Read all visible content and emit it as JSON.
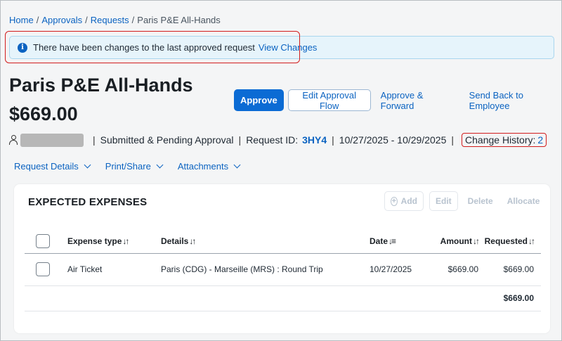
{
  "breadcrumb": {
    "home": "Home",
    "approvals": "Approvals",
    "requests": "Requests",
    "current": "Paris P&E All-Hands",
    "separator": "/"
  },
  "alert": {
    "message": "There have been changes to the last approved request",
    "link": "View Changes"
  },
  "request": {
    "title": "Paris P&E All-Hands",
    "amount": "$669.00",
    "status": "Submitted & Pending Approval",
    "request_id_label": "Request ID:",
    "request_id": "3HY4",
    "dates": "10/27/2025 - 10/29/2025",
    "change_history_label": "Change History:",
    "change_history_count": "2"
  },
  "actions": {
    "approve": "Approve",
    "edit_flow": "Edit Approval Flow",
    "approve_forward": "Approve & Forward",
    "send_back": "Send Back to Employee"
  },
  "tabs": {
    "details": "Request Details",
    "print": "Print/Share",
    "attachments": "Attachments"
  },
  "expenses": {
    "title": "EXPECTED EXPENSES",
    "toolbar": {
      "add": "Add",
      "edit": "Edit",
      "delete": "Delete",
      "allocate": "Allocate"
    },
    "columns": {
      "type": "Expense type",
      "details": "Details",
      "date": "Date",
      "amount": "Amount",
      "requested": "Requested"
    },
    "rows": [
      {
        "type": "Air Ticket",
        "details": "Paris (CDG) - Marseille (MRS) : Round Trip",
        "date": "10/27/2025",
        "amount": "$669.00",
        "requested": "$669.00"
      }
    ],
    "total": "$669.00"
  }
}
